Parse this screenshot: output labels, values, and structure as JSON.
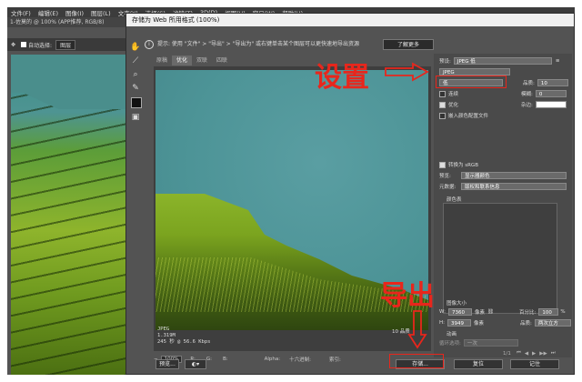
{
  "app": {
    "menu": [
      "文件(F)",
      "编辑(E)",
      "图像(I)",
      "图层(L)",
      "文字(Y)",
      "选择(S)",
      "滤镜(T)",
      "3D(D)",
      "视图(V)",
      "窗口(W)",
      "帮助(H)"
    ],
    "doc_tab": "1-佐莫的 @ 100% (APP推荐, RGB/8)",
    "options": {
      "auto_select": "自动选择:",
      "layer": "图层"
    }
  },
  "dialog": {
    "title": "存储为 Web 所用格式 (100%)",
    "hint": "提示: 使用 \"文件\" > \"导出\" > \"导出为\" 或右键单击某个图层可以更快速地导出资源",
    "learn_more": "了解更多",
    "tabs": [
      "原稿",
      "优化",
      "双联",
      "四联"
    ],
    "active_tab": "优化",
    "preview": {
      "format": "JPEG",
      "size": "1.319M",
      "time": "245 秒 @ 56.6 Kbps",
      "quality_readout": "10 品质"
    },
    "zoom": {
      "value": "100%",
      "r": "R:",
      "g": "G:",
      "b": "B:",
      "alpha": "Alpha:",
      "hex": "十六进制:",
      "index": "索引:"
    },
    "settings": {
      "preset_label": "预设:",
      "preset_value": "JPEG 低",
      "format": "JPEG",
      "quality_preset": "低",
      "quality_label": "品质:",
      "quality_value": "10",
      "progressive": "连续",
      "blur_label": "模糊:",
      "blur_value": "0",
      "optimized": "优化",
      "matte_label": "杂边:",
      "embed_profile": "嵌入颜色配置文件",
      "convert_srgb": "转换为 sRGB",
      "preview_label": "预览:",
      "preview_value": "显示器颜色",
      "metadata_label": "元数据:",
      "metadata_value": "版权和联系信息",
      "color_table": "颜色表"
    },
    "image_size": {
      "title": "图像大小",
      "w_label": "W:",
      "w_value": "7360",
      "h_label": "H:",
      "h_value": "3949",
      "unit": "像素",
      "percent_label": "百分比:",
      "percent_value": "100",
      "percent_unit": "%",
      "quality_label": "品质:",
      "quality_value": "两次立方"
    },
    "animation": {
      "title": "动画",
      "loop_label": "循环选项:",
      "loop_value": "一次",
      "frame": "1/1"
    },
    "buttons": {
      "preview": "预览...",
      "save": "存储...",
      "reset": "复位",
      "remember": "记住"
    }
  },
  "annotations": {
    "settings_text": "设置",
    "export_text": "导出",
    "color": "#e8261c"
  }
}
